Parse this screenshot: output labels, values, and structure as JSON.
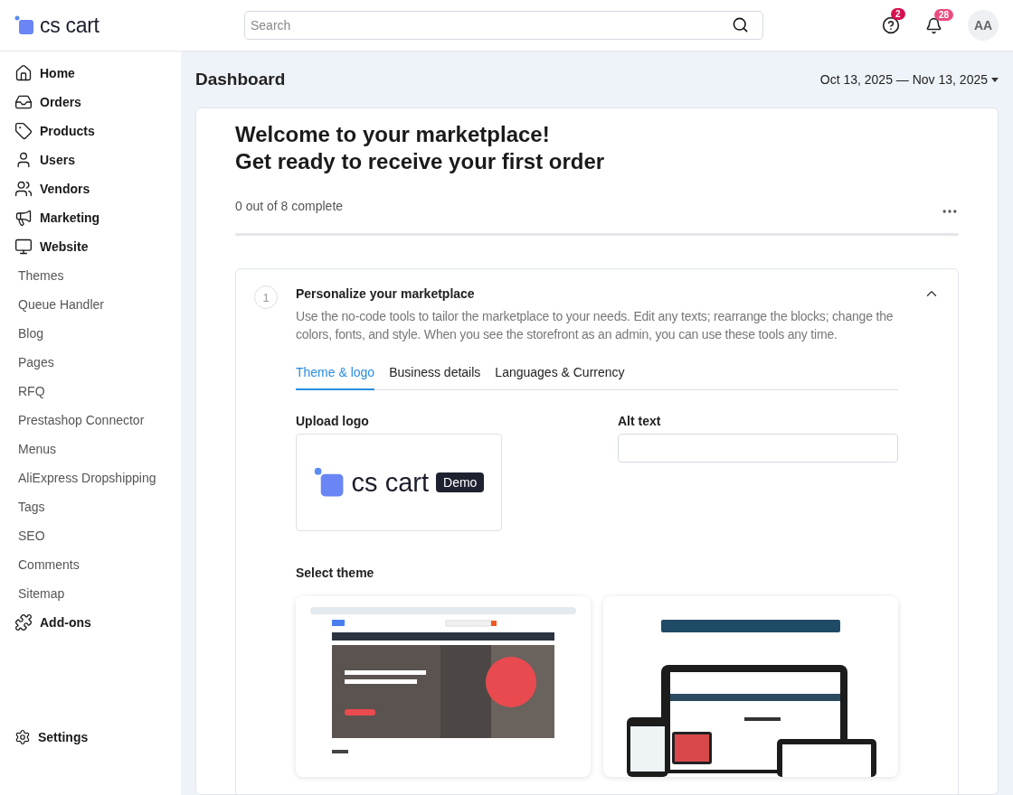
{
  "header": {
    "logo": "cs cart",
    "search": {
      "placeholder": "Search"
    },
    "help_badge": "2",
    "notifications_badge": "28",
    "avatar": "AA"
  },
  "sidebar": {
    "items": [
      {
        "label": "Home",
        "kind": "section"
      },
      {
        "label": "Orders",
        "kind": "section"
      },
      {
        "label": "Products",
        "kind": "section"
      },
      {
        "label": "Users",
        "kind": "section"
      },
      {
        "label": "Vendors",
        "kind": "section"
      },
      {
        "label": "Marketing",
        "kind": "section"
      },
      {
        "label": "Website",
        "kind": "section"
      },
      {
        "label": "Themes",
        "kind": "sub"
      },
      {
        "label": "Queue Handler",
        "kind": "sub"
      },
      {
        "label": "Blog",
        "kind": "sub"
      },
      {
        "label": "Pages",
        "kind": "sub"
      },
      {
        "label": "RFQ",
        "kind": "sub"
      },
      {
        "label": "Prestashop Connector",
        "kind": "sub"
      },
      {
        "label": "Menus",
        "kind": "sub"
      },
      {
        "label": "AliExpress Dropshipping",
        "kind": "sub"
      },
      {
        "label": "Tags",
        "kind": "sub"
      },
      {
        "label": "SEO",
        "kind": "sub"
      },
      {
        "label": "Comments",
        "kind": "sub"
      },
      {
        "label": "Sitemap",
        "kind": "sub"
      },
      {
        "label": "Add-ons",
        "kind": "section"
      }
    ],
    "footer_item": "Settings"
  },
  "page": {
    "title": "Dashboard",
    "date_range": "Oct 13, 2025 — Nov 13, 2025"
  },
  "onboarding": {
    "title_lines": [
      "Welcome to your marketplace!",
      "Get ready to receive your first order"
    ],
    "progress_text": "0 out of 8 complete",
    "level": 0,
    "step": {
      "number": "1",
      "title": "Personalize your marketplace",
      "expanded": true,
      "description": "Use the no-code tools to tailor the marketplace to your needs. Edit any texts; rearrange the blocks; change the colors, fonts, and style. When you see the storefront as an admin, you can use these tools any time.",
      "tabs": [
        {
          "label": "Theme & logo",
          "selected": true
        },
        {
          "label": "Business details",
          "selected": false
        },
        {
          "label": "Languages & Currency",
          "selected": false
        }
      ],
      "upload_logo": {
        "label": "Upload logo",
        "logo_name": "cs cart",
        "logo_badge": "Demo"
      },
      "alt_text": {
        "label": "Alt text"
      },
      "select_theme": {
        "label": "Select theme"
      }
    }
  }
}
